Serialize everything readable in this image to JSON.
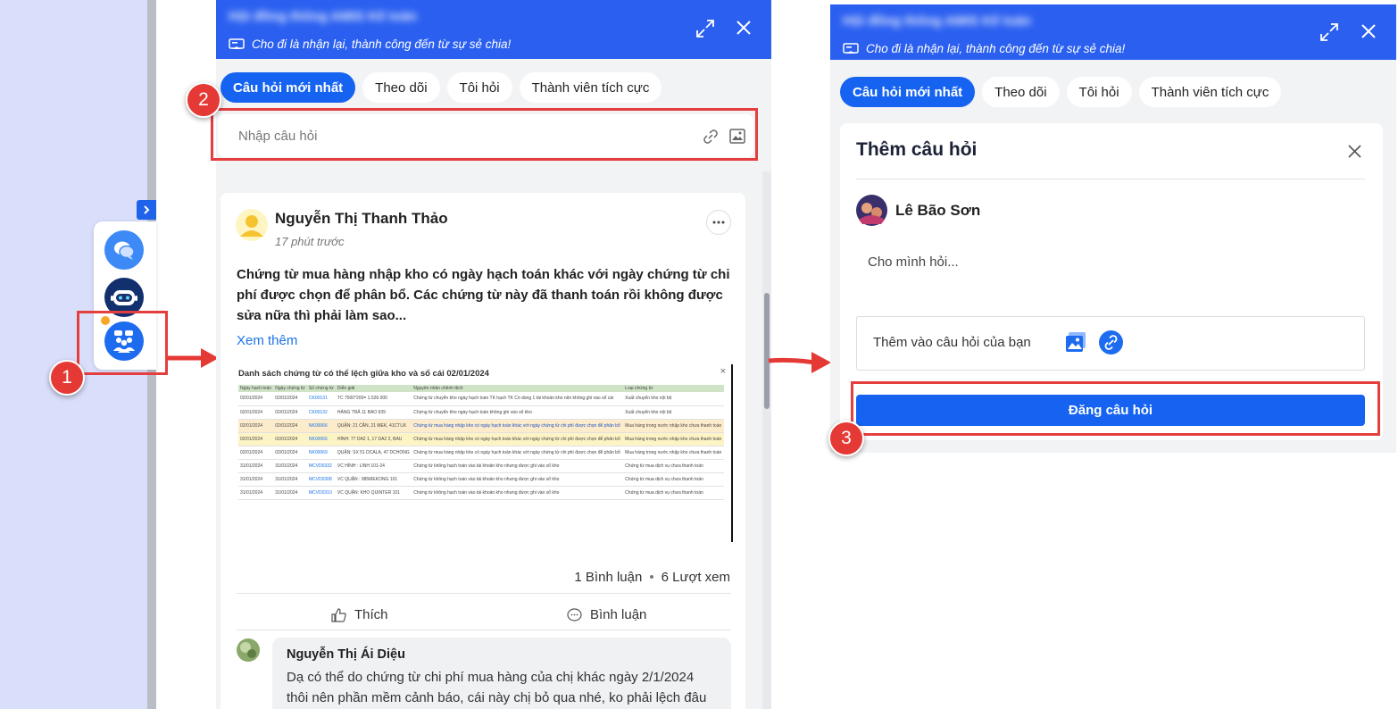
{
  "panel": {
    "blurred_title": "Hội đồng thông AMIS Kế toán",
    "slogan": "Cho đi là nhận lại, thành công đến từ sự sẻ chia!",
    "tabs": [
      "Câu hỏi mới nhất",
      "Theo dõi",
      "Tôi hỏi",
      "Thành viên tích cực"
    ]
  },
  "left_panel": {
    "search_placeholder": "Nhập câu hỏi",
    "post": {
      "author": "Nguyễn Thị Thanh Thảo",
      "time": "17 phút trước",
      "content": "Chứng từ mua hàng nhập kho có ngày hạch toán khác với ngày chứng từ chi phí được chọn để phân bổ. Các chứng từ này đã thanh toán rồi không được sửa nữa thì phải làm sao...",
      "see_more": "Xem thêm",
      "attachment_title": "Danh sách chứng từ có thể lệch giữa kho và sổ cái 02/01/2024",
      "stats_comments": "1 Bình luận",
      "stats_dot": "•",
      "stats_views": "6 Lượt xem",
      "like_label": "Thích",
      "comment_label": "Bình luận"
    },
    "comment": {
      "author": "Nguyễn Thị Ái Diệu",
      "text_line1": "Dạ có thể do chứng từ chi phí mua hàng của chị khác ngày 2/1/2024",
      "text_line2": "thôi nên phần mềm cảnh báo, cái này chị bỏ qua nhé, ko phải lệch đâu"
    }
  },
  "attachment_table": {
    "headers": [
      "Ngày hạch toán",
      "Ngày chứng từ",
      "Số chứng từ",
      "Diễn giải",
      "Nguyên nhân chênh lệch",
      "Loại chứng từ"
    ],
    "rows": [
      [
        "02/01/2024",
        "02/01/2024",
        "CK00131",
        "TC 7500*200= 1.526.000",
        "Chứng từ chuyển kho ngày hạch toán TK hạch TK Có dùng 1 tài khoản kho nên không ghi vào sổ cái",
        "Xuất chuyển kho nội bộ"
      ],
      [
        "02/01/2024",
        "02/01/2024",
        "CK00132",
        "HÀNG TRẢ 11 BAO 939",
        "Chứng từ chuyển kho ngày hạch toán không ghi vào sổ kho",
        "Xuất chuyển kho nội bộ"
      ],
      [
        "02/01/2024",
        "02/01/2024",
        "NK00066",
        "QUẬN: 21 CẦN, 21 MEK, 41CTUX",
        "Chứng từ mua hàng nhập kho có ngày hạch toán khác với ngày chứng từ chi phí được chọn để phân bổ",
        "Mua hàng trong nước nhập kho chưa thanh toán"
      ],
      [
        "02/01/2024",
        "02/01/2024",
        "NK00066",
        "HÌNH: 77 DA2 1, 17 DA2 2, BAU",
        "Chứng từ mua hàng nhập kho có ngày hạch toán khác với ngày chứng từ chi phí được chọn để phân bổ",
        "Mua hàng trong nước nhập kho chưa thanh toán"
      ],
      [
        "02/01/2024",
        "02/01/2024",
        "NK00069",
        "QUẬN: SX 51 DCALA, 47 DCHONG",
        "Chứng từ mua hàng nhập kho có ngày hạch toán khác với ngày chứng từ chi phí được chọn để phân bổ",
        "Mua hàng trong nước nhập kho chưa thanh toán"
      ],
      [
        "31/01/2024",
        "31/01/2024",
        "MCVD0332",
        "VC HÌNH : LINH 101-24",
        "Chứng từ không hạch toán vào tài khoản kho nhưng được ghi vào sổ kho",
        "Chứng từ mua dịch vụ chưa thanh toán"
      ],
      [
        "31/01/2024",
        "31/01/2024",
        "MCVD0308",
        "VC QUẬN : 985MEKONG 101",
        "Chứng từ không hạch toán vào tài khoản kho nhưng được ghi vào sổ kho",
        "Chứng từ mua dịch vụ chưa thanh toán"
      ],
      [
        "31/01/2024",
        "31/01/2024",
        "MCVD0310",
        "VC QUẬN: KHO QUINTER 101",
        "Chứng từ không hạch toán vào tài khoản kho nhưng được ghi vào sổ kho",
        "Chứng từ mua dịch vụ chưa thanh toán"
      ]
    ]
  },
  "right_panel": {
    "dialog_title": "Thêm câu hỏi",
    "user_name": "Lê Bão Sơn",
    "question_placeholder": "Cho mình hỏi...",
    "add_to_question": "Thêm vào câu hỏi của bạn",
    "submit_label": "Đăng câu hỏi"
  },
  "badges": [
    "1",
    "2",
    "3"
  ],
  "colors": {
    "header_blue": "#2a5ff0",
    "active_tab": "#1563f0",
    "highlight_red": "#e53e3e",
    "badge_red": "#e53935",
    "sidebar_bg": "#d9defa"
  },
  "icons": [
    "chevron-right-icon",
    "chat-bubbles-icon",
    "robot-icon",
    "community-icon",
    "expand-icon",
    "close-icon",
    "megaphone-icon",
    "link-icon",
    "image-icon",
    "more-icon",
    "like-icon",
    "comment-icon",
    "arrow-right-icon"
  ]
}
